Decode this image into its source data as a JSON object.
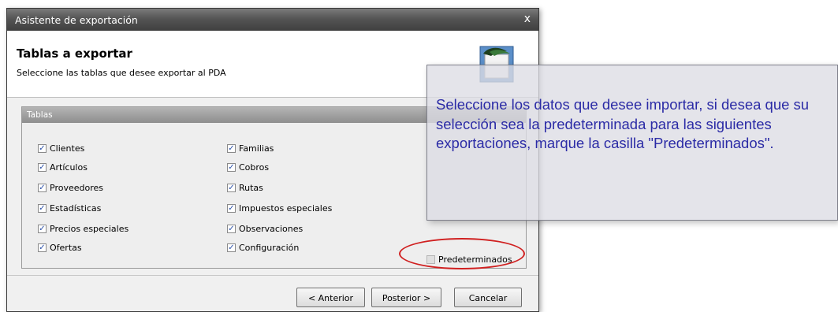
{
  "window": {
    "title": "Asistente de exportación",
    "close_label": "x"
  },
  "header": {
    "heading": "Tablas a exportar",
    "subheading": "Seleccione las tablas que desee exportar al PDA",
    "icon": "pda-export-icon"
  },
  "tables_group": {
    "label": "Tablas",
    "left_column": [
      {
        "label": "Clientes",
        "checked": true
      },
      {
        "label": "Artículos",
        "checked": true
      },
      {
        "label": "Proveedores",
        "checked": true
      },
      {
        "label": "Estadísticas",
        "checked": true
      },
      {
        "label": "Precios especiales",
        "checked": true
      },
      {
        "label": "Ofertas",
        "checked": true
      }
    ],
    "right_column": [
      {
        "label": "Familias",
        "checked": true
      },
      {
        "label": "Cobros",
        "checked": true
      },
      {
        "label": "Rutas",
        "checked": true
      },
      {
        "label": "Impuestos especiales",
        "checked": true
      },
      {
        "label": "Observaciones",
        "checked": true
      },
      {
        "label": "Configuración",
        "checked": true
      }
    ],
    "default_checkbox": {
      "label": "Predeterminados",
      "checked": false
    }
  },
  "buttons": {
    "back_label": "< Anterior",
    "next_label": "Posterior >",
    "cancel_label": "Cancelar"
  },
  "callout": {
    "text": "Seleccione los datos que desee importar, si desea que su selección sea la predeterminada para las siguientes exportaciones, marque la casilla \"Predeterminados\"."
  },
  "colors": {
    "callout_text": "#2b2ba6",
    "highlight_ring": "#d02020",
    "checkmark": "#2a4fa8"
  }
}
